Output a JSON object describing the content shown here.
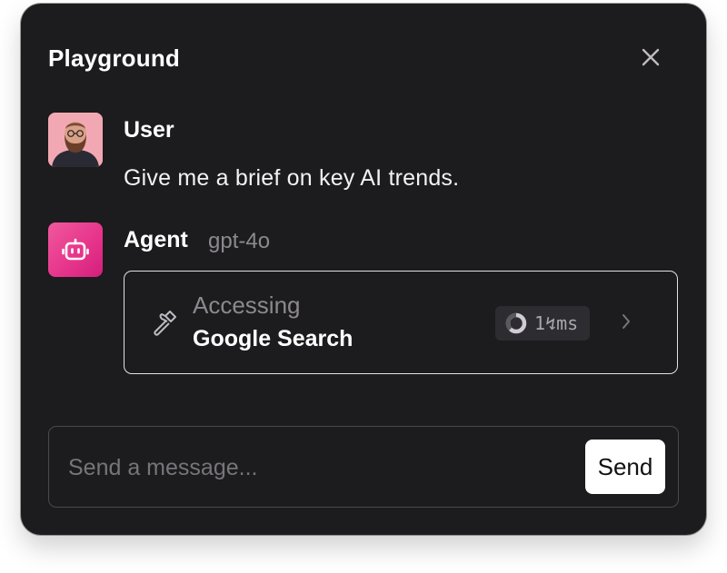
{
  "panel": {
    "title": "Playground"
  },
  "user": {
    "name": "User",
    "message": "Give me a brief on key AI trends."
  },
  "agent": {
    "name": "Agent",
    "model": "gpt-4o"
  },
  "tool_call": {
    "status": "Accessing",
    "tool": "Google Search",
    "elapsed": "1↯ms"
  },
  "composer": {
    "placeholder": "Send a message...",
    "value": "",
    "send_label": "Send"
  },
  "colors": {
    "background": "#1c1b1d",
    "agent_avatar": "#e6338a",
    "muted_text": "#8b898f"
  },
  "icons": [
    "close-icon",
    "robot-icon",
    "hammer-icon",
    "spinner-icon",
    "chevron-right-icon"
  ]
}
